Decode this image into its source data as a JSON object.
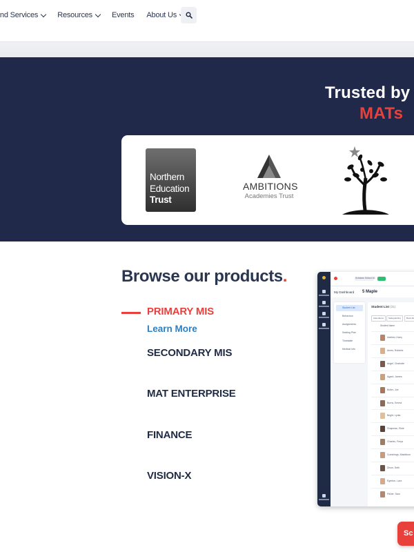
{
  "nav": {
    "items": [
      {
        "label": "and Services",
        "has_dropdown": true
      },
      {
        "label": "Resources",
        "has_dropdown": true
      },
      {
        "label": "Events",
        "has_dropdown": false
      },
      {
        "label": "About Us",
        "has_dropdown": true
      }
    ],
    "search_icon": "search-icon"
  },
  "trusted": {
    "line1": "Trusted by",
    "line2": "MATs",
    "logos": {
      "northern": {
        "line1": "Northern",
        "line2": "Education",
        "line3": "Trust"
      },
      "ambitions": {
        "name": "AMBITIONS",
        "sub": "Academies Trust"
      },
      "tree": "tree-logo"
    }
  },
  "products": {
    "title": "Browse our products",
    "title_dot": ".",
    "items": [
      {
        "label": "PRIMARY MIS",
        "active": true
      },
      {
        "label": "SECONDARY MIS",
        "active": false
      },
      {
        "label": "MAT ENTERPRISE",
        "active": false
      },
      {
        "label": "FINANCE",
        "active": false
      },
      {
        "label": "VISION-X",
        "active": false
      }
    ],
    "learn_more": "Learn More"
  },
  "app_preview": {
    "school": "Scholars School 63",
    "dashboard": "My Dashboard",
    "class": "5 Maple",
    "list_title": "Student List",
    "list_count": "(31)",
    "tabs": [
      "Attendance",
      "Safeguarding",
      "Book Marks"
    ],
    "column": "Student Name",
    "menu": [
      "Student List",
      "Behaviour",
      "Assignments",
      "Seating Plan",
      "Timetable",
      "Medical Info"
    ],
    "students": [
      "Adebisi, Harry",
      "Ames, Roberta",
      "Angel, Charlotte",
      "Agard, James",
      "Butler, Joe",
      "Burns, Emma",
      "Bright, Lydia",
      "Chapman, Elsie",
      "Charles, Freya",
      "Cummings, Maddison",
      "Dixon, Seth",
      "Egerton, Lara",
      "Fisher, Sam"
    ]
  },
  "float_button": {
    "label": "Sc"
  },
  "colors": {
    "navy": "#21294b",
    "accent": "#e8413c",
    "link": "#2d7fc0"
  }
}
